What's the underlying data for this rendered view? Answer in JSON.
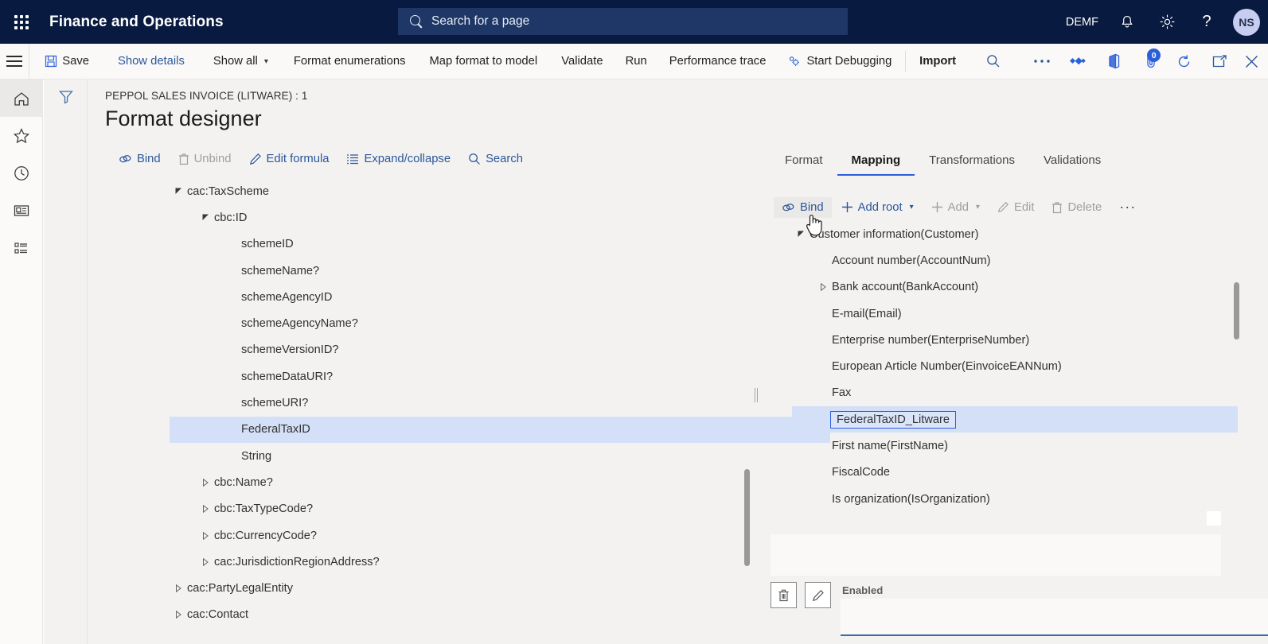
{
  "topbar": {
    "waffle_icon": "app-launcher-icon",
    "brand": "Finance and Operations",
    "search": {
      "placeholder": "Search for a page",
      "icon": "search-icon"
    },
    "company": "DEMF",
    "notifications_icon": "bell-icon",
    "settings_icon": "gear-icon",
    "help_icon": "question-mark-icon",
    "avatar_initials": "NS"
  },
  "commandbar": {
    "menu_icon": "hamburger-icon",
    "save": "Save",
    "show_details": "Show details",
    "show_all": "Show all",
    "format_enumerations": "Format enumerations",
    "map_format_to_model": "Map format to model",
    "validate": "Validate",
    "run": "Run",
    "performance_trace": "Performance trace",
    "start_debugging": "Start Debugging",
    "import": "Import",
    "search_icon": "search-icon",
    "overflow_icon": "ellipsis-icon",
    "share_icon": "share-diamond-icon",
    "office_icon": "office-app-icon",
    "attachments_icon": "attachment-icon",
    "attachments_count": "0",
    "refresh_icon": "refresh-icon",
    "popout_icon": "open-in-new-window-icon",
    "close_icon": "close-icon"
  },
  "rail": {
    "items": [
      {
        "name": "home-icon",
        "label": "Home",
        "active": true
      },
      {
        "name": "star-icon",
        "label": "Favorites",
        "active": false
      },
      {
        "name": "clock-icon",
        "label": "Recent",
        "active": false
      },
      {
        "name": "workspaces-icon",
        "label": "Workspaces",
        "active": false
      },
      {
        "name": "modules-icon",
        "label": "Modules",
        "active": false
      }
    ]
  },
  "filter_icon": "filter-funnel-icon",
  "page": {
    "breadcrumb": "PEPPOL SALES INVOICE (LITWARE) : 1",
    "title": "Format designer"
  },
  "left_toolbar": [
    {
      "label": "Bind",
      "icon": "link-bind-icon",
      "disabled": false
    },
    {
      "label": "Unbind",
      "icon": "trash-unbind-icon",
      "disabled": true
    },
    {
      "label": "Edit formula",
      "icon": "pencil-icon",
      "disabled": false
    },
    {
      "label": "Expand/collapse",
      "icon": "list-expand-icon",
      "disabled": false
    },
    {
      "label": "Search",
      "icon": "search-icon",
      "disabled": false
    }
  ],
  "left_tree": [
    {
      "label": "cac:TaxScheme",
      "indent": 0,
      "caret": "expanded",
      "selected": false
    },
    {
      "label": "cbc:ID",
      "indent": 1,
      "caret": "expanded",
      "selected": false
    },
    {
      "label": "schemeID",
      "indent": 2,
      "caret": "none",
      "selected": false
    },
    {
      "label": "schemeName?",
      "indent": 2,
      "caret": "none",
      "selected": false
    },
    {
      "label": "schemeAgencyID",
      "indent": 2,
      "caret": "none",
      "selected": false
    },
    {
      "label": "schemeAgencyName?",
      "indent": 2,
      "caret": "none",
      "selected": false
    },
    {
      "label": "schemeVersionID?",
      "indent": 2,
      "caret": "none",
      "selected": false
    },
    {
      "label": "schemeDataURI?",
      "indent": 2,
      "caret": "none",
      "selected": false
    },
    {
      "label": "schemeURI?",
      "indent": 2,
      "caret": "none",
      "selected": false
    },
    {
      "label": "FederalTaxID",
      "indent": 2,
      "caret": "none",
      "selected": true
    },
    {
      "label": "String",
      "indent": 2,
      "caret": "none",
      "selected": false
    },
    {
      "label": "cbc:Name?",
      "indent": 1,
      "caret": "collapsed",
      "selected": false
    },
    {
      "label": "cbc:TaxTypeCode?",
      "indent": 1,
      "caret": "collapsed",
      "selected": false
    },
    {
      "label": "cbc:CurrencyCode?",
      "indent": 1,
      "caret": "collapsed",
      "selected": false
    },
    {
      "label": "cac:JurisdictionRegionAddress?",
      "indent": 1,
      "caret": "collapsed",
      "selected": false
    },
    {
      "label": "cac:PartyLegalEntity",
      "indent": 0,
      "caret": "collapsed",
      "selected": false
    },
    {
      "label": "cac:Contact",
      "indent": 0,
      "caret": "collapsed",
      "selected": false
    }
  ],
  "right_tabs": [
    {
      "label": "Format",
      "active": false
    },
    {
      "label": "Mapping",
      "active": true
    },
    {
      "label": "Transformations",
      "active": false
    },
    {
      "label": "Validations",
      "active": false
    }
  ],
  "right_toolbar": [
    {
      "label": "Bind",
      "icon": "link-bind-icon",
      "disabled": false,
      "hover": true,
      "chevron": false
    },
    {
      "label": "Add root",
      "icon": "plus-icon",
      "disabled": false,
      "hover": false,
      "chevron": true
    },
    {
      "label": "Add",
      "icon": "plus-icon",
      "disabled": true,
      "hover": false,
      "chevron": true
    },
    {
      "label": "Edit",
      "icon": "pencil-icon",
      "disabled": true,
      "hover": false,
      "chevron": false
    },
    {
      "label": "Delete",
      "icon": "trash-icon",
      "disabled": true,
      "hover": false,
      "chevron": false
    },
    {
      "label": "···",
      "icon": "ellipsis-icon",
      "disabled": false,
      "hover": false,
      "chevron": false
    }
  ],
  "right_tree": [
    {
      "label": "Customer information(Customer)",
      "indent": 0,
      "caret": "expanded",
      "selected": false,
      "boxed": false
    },
    {
      "label": "Account number(AccountNum)",
      "indent": 1,
      "caret": "none",
      "selected": false,
      "boxed": false
    },
    {
      "label": "Bank account(BankAccount)",
      "indent": 1,
      "caret": "collapsed",
      "selected": false,
      "boxed": false
    },
    {
      "label": "E-mail(Email)",
      "indent": 1,
      "caret": "none",
      "selected": false,
      "boxed": false
    },
    {
      "label": "Enterprise number(EnterpriseNumber)",
      "indent": 1,
      "caret": "none",
      "selected": false,
      "boxed": false
    },
    {
      "label": "European Article Number(EinvoiceEANNum)",
      "indent": 1,
      "caret": "none",
      "selected": false,
      "boxed": false
    },
    {
      "label": "Fax",
      "indent": 1,
      "caret": "none",
      "selected": false,
      "boxed": false
    },
    {
      "label": "FederalTaxID_Litware",
      "indent": 1,
      "caret": "none",
      "selected": true,
      "boxed": true
    },
    {
      "label": "First name(FirstName)",
      "indent": 1,
      "caret": "none",
      "selected": false,
      "boxed": false
    },
    {
      "label": "FiscalCode",
      "indent": 1,
      "caret": "none",
      "selected": false,
      "boxed": false
    },
    {
      "label": "Is organization(IsOrganization)",
      "indent": 1,
      "caret": "none",
      "selected": false,
      "boxed": false
    }
  ],
  "detail": {
    "delete_icon": "trash-icon",
    "edit_icon": "pencil-icon",
    "enabled_label": "Enabled"
  },
  "colors": {
    "topbar_bg": "#081a3f",
    "accent_blue": "#2b5fd9",
    "link_blue": "#2b579a",
    "selection_bg": "#d4e0f7",
    "workspace_bg": "#f3f2f1",
    "disabled_text": "#a19f9d"
  }
}
